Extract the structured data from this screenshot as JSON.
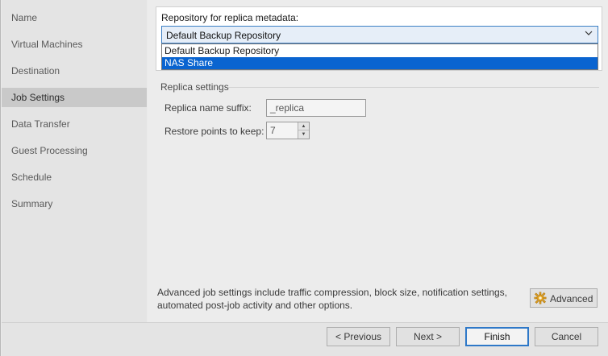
{
  "sidebar": {
    "steps": [
      {
        "label": "Name"
      },
      {
        "label": "Virtual Machines"
      },
      {
        "label": "Destination"
      },
      {
        "label": "Job Settings"
      },
      {
        "label": "Data Transfer"
      },
      {
        "label": "Guest Processing"
      },
      {
        "label": "Schedule"
      },
      {
        "label": "Summary"
      }
    ],
    "active_step": "Job Settings"
  },
  "repository": {
    "label": "Repository for replica metadata:",
    "selected": "Default Backup Repository",
    "options": [
      "Default Backup Repository",
      "NAS Share"
    ],
    "highlighted_option": "NAS Share"
  },
  "replica_settings": {
    "title": "Replica settings",
    "name_suffix_label": "Replica name suffix:",
    "name_suffix_value": "_replica",
    "restore_points_label": "Restore points to keep:",
    "restore_points_value": "7"
  },
  "advanced": {
    "description_line1": "Advanced job settings include traffic compression, block size, notification settings,",
    "description_line2": "automated post-job activity and other options.",
    "button_label": "Advanced",
    "icon": "gear-icon"
  },
  "footer": {
    "previous_label": "< Previous",
    "next_label": "Next >",
    "finish_label": "Finish",
    "cancel_label": "Cancel"
  },
  "colors": {
    "accent": "#0a64d0",
    "focus_border": "#2e78c8"
  }
}
